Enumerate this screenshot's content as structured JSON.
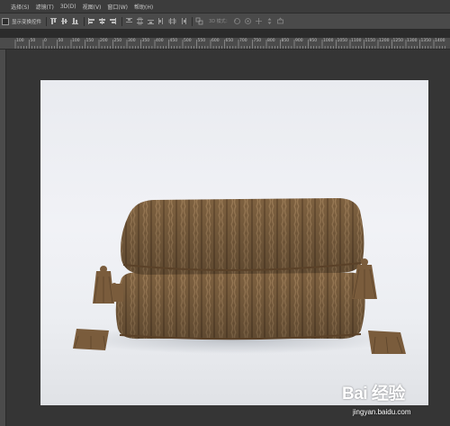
{
  "menubar": {
    "items": [
      "选择(S)",
      "滤镜(T)",
      "3D(D)",
      "视图(V)",
      "窗口(W)",
      "帮助(H)"
    ]
  },
  "options_bar": {
    "show_transform_controls_label": "显示变换控件",
    "mode_3d_label": "3D 模式："
  },
  "ruler": {
    "top_labels": [
      "100",
      "50",
      "0",
      "50",
      "100",
      "150",
      "200",
      "250",
      "300",
      "350",
      "400",
      "450",
      "500",
      "550",
      "600",
      "650",
      "700",
      "750",
      "800",
      "850",
      "900",
      "950",
      "1000",
      "1050",
      "1100",
      "1150",
      "1200",
      "1250",
      "1300",
      "1350",
      "1400",
      "1450"
    ]
  },
  "document": {
    "background_color": "#ebedf1",
    "pillow_color": "#7e6140"
  },
  "watermark": {
    "brand": "Bai 经验",
    "url": "jingyan.baidu.com"
  }
}
